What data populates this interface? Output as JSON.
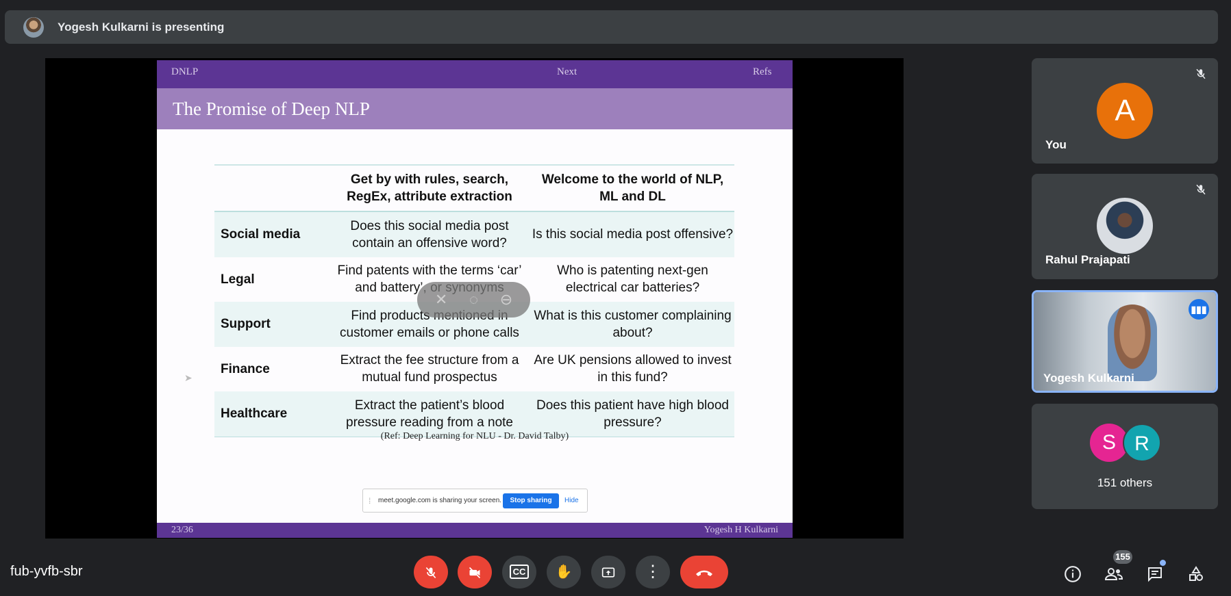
{
  "presenter_bar": {
    "text": "Yogesh Kulkarni is presenting"
  },
  "slide": {
    "nav": {
      "left": "DNLP",
      "center": "Next",
      "right": "Refs"
    },
    "title": "The Promise of Deep NLP",
    "table": {
      "headers": [
        "",
        "Get by with rules, search, RegEx, attribute extraction",
        "Welcome to the world of NLP, ML and DL"
      ],
      "rows": [
        {
          "label": "Social media",
          "rules": "Does this social media post contain an offensive word?",
          "deep": "Is this social media post offensive?"
        },
        {
          "label": "Legal",
          "rules": "Find patents with the terms ‘car’ and battery’, or synonyms",
          "deep": "Who is patenting next-gen electrical car batteries?"
        },
        {
          "label": "Support",
          "rules": "Find products mentioned in customer emails or phone calls",
          "deep": "What is this customer complaining about?"
        },
        {
          "label": "Finance",
          "rules": "Extract the fee structure from a mutual fund prospectus",
          "deep": "Are UK pensions allowed to invest in this fund?"
        },
        {
          "label": "Healthcare",
          "rules": "Extract the patient’s blood pressure reading from a note",
          "deep": "Does this patient have high blood pressure?"
        }
      ]
    },
    "ref": "(Ref: Deep Learning for NLU - Dr. David Talby)",
    "footer": {
      "left": "23/36",
      "right": "Yogesh H Kulkarni"
    }
  },
  "share_banner": {
    "message": "meet.google.com is sharing your screen.",
    "stop_label": "Stop sharing",
    "hide_label": "Hide"
  },
  "hover_controls": {
    "icons": [
      "unpin-icon",
      "mute-presentation-icon",
      "remove-icon"
    ]
  },
  "participants": [
    {
      "name": "You",
      "avatar_letter": "A",
      "avatar_color": "#e8710a",
      "muted": true
    },
    {
      "name": "Rahul Prajapati",
      "muted": true
    },
    {
      "name": "Yogesh Kulkarni",
      "speaking": true
    },
    {
      "others_text": "151 others",
      "avatars": [
        {
          "letter": "S",
          "color": "#e52592"
        },
        {
          "letter": "R",
          "color": "#12a4af"
        }
      ]
    }
  ],
  "meeting_code": "fub-yvfb-sbr",
  "controls": {
    "buttons": [
      "mic-off-icon",
      "camera-off-icon",
      "captions-icon",
      "raise-hand-icon",
      "present-icon",
      "more-options-icon",
      "end-call-icon"
    ],
    "people_count": "155",
    "colors": {
      "red": "#ea4335",
      "dark": "#3c4043",
      "accent": "#1a73e8"
    }
  }
}
